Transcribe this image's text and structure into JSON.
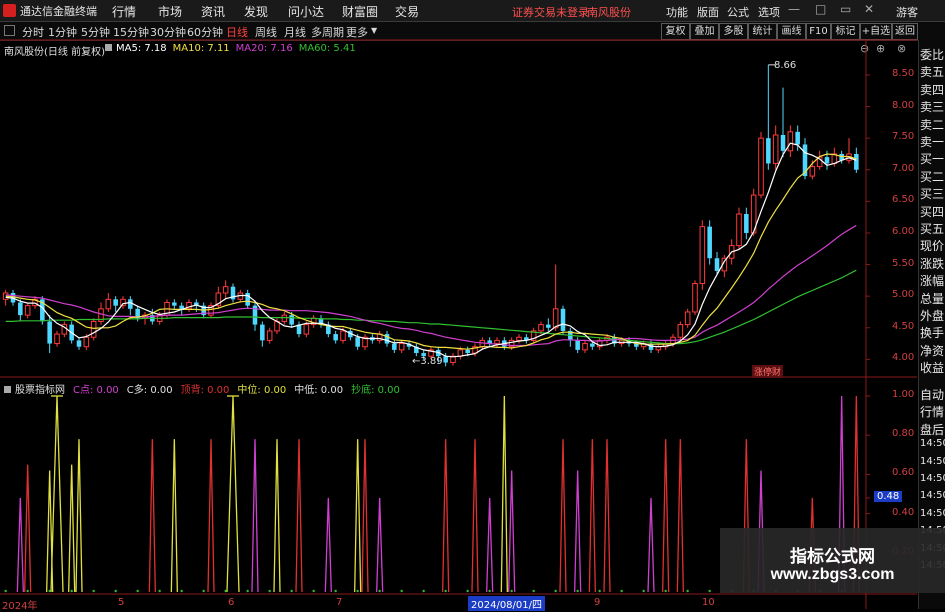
{
  "menubar": {
    "app_name": "通达信金融终端",
    "items": [
      "行情",
      "市场",
      "资讯",
      "发现",
      "问小达",
      "财富圈",
      "交易"
    ],
    "notice": "证券交易未登录",
    "stock": "南风股份",
    "right_items": [
      "功能",
      "版面",
      "公式",
      "选项"
    ],
    "guest": "游客"
  },
  "toolbar": {
    "periods": [
      "分时",
      "1分钟",
      "5分钟",
      "15分钟",
      "30分钟",
      "60分钟",
      "日线",
      "周线",
      "月线",
      "多周期",
      "更多"
    ],
    "active_period": "日线",
    "right_buttons": [
      "复权",
      "叠加",
      "多股",
      "统计",
      "画线",
      "F10",
      "标记",
      "+自选",
      "返回"
    ]
  },
  "chart_header": {
    "title": "南风股份(日线 前复权)",
    "ma": [
      {
        "label": "MA5: 7.18",
        "color": "#ffffff"
      },
      {
        "label": "MA10: 7.11",
        "color": "#f0e040"
      },
      {
        "label": "MA20: 7.16",
        "color": "#d040d0"
      },
      {
        "label": "MA60: 5.41",
        "color": "#30c030"
      }
    ]
  },
  "main_chart": {
    "yticks": [
      "8.50",
      "8.00",
      "7.50",
      "7.00",
      "6.50",
      "6.00",
      "5.50",
      "5.00",
      "4.50",
      "4.00"
    ],
    "high_label": "8.66",
    "low_label": "3.89",
    "badge": "涨停财"
  },
  "indicator": {
    "name": "股票指标网",
    "items": [
      {
        "label": "C点: 0.00",
        "color": "#d040d0"
      },
      {
        "label": "C多: 0.00",
        "color": "#e0e0e0"
      },
      {
        "label": "顶背: 0.00",
        "color": "#e03030"
      },
      {
        "label": "中位: 0.00",
        "color": "#e0e040"
      },
      {
        "label": "中低: 0.00",
        "color": "#e0e0e0"
      },
      {
        "label": "抄底: 0.00",
        "color": "#30c030"
      }
    ],
    "yticks": [
      "1.00",
      "0.80",
      "0.60",
      "0.48",
      "0.40",
      "0.20"
    ],
    "current_value": "0.48"
  },
  "x_axis": {
    "labels": [
      "2024年",
      "5",
      "6",
      "7",
      "2024/08/01/四",
      "9",
      "10"
    ]
  },
  "right_panel": {
    "quote_items": [
      "委比",
      "卖五",
      "卖四",
      "卖三",
      "卖二",
      "卖一",
      "买一",
      "买二",
      "买三",
      "买四",
      "买五",
      "现价",
      "涨跌",
      "涨幅",
      "总量",
      "外盘",
      "换手",
      "净资",
      "收益"
    ],
    "lower_items": [
      "自动",
      "行情",
      "盘后",
      "14:50",
      "14:50",
      "14:50",
      "14:50",
      "14:50",
      "14:50",
      "14:50",
      "14:50"
    ]
  },
  "watermark": {
    "line1": "指标公式网",
    "line2": "www.zbgs3.com"
  },
  "chart_data": {
    "type": "candlestick",
    "title": "南风股份(日线 前复权)",
    "ylim": [
      3.8,
      8.8
    ],
    "ma_values": {
      "MA5": 7.18,
      "MA10": 7.11,
      "MA20": 7.16,
      "MA60": 5.41
    },
    "candles": [
      [
        4.95,
        5.05,
        5.1,
        4.85
      ],
      [
        5.05,
        4.9,
        5.1,
        4.85
      ],
      [
        4.9,
        4.7,
        4.95,
        4.6
      ],
      [
        4.7,
        4.85,
        4.9,
        4.65
      ],
      [
        4.85,
        4.95,
        5.0,
        4.8
      ],
      [
        4.95,
        4.6,
        5.0,
        4.55
      ],
      [
        4.6,
        4.25,
        4.7,
        4.1
      ],
      [
        4.25,
        4.4,
        4.45,
        4.2
      ],
      [
        4.4,
        4.55,
        4.6,
        4.35
      ],
      [
        4.55,
        4.3,
        4.6,
        4.25
      ],
      [
        4.3,
        4.2,
        4.35,
        4.15
      ],
      [
        4.2,
        4.35,
        4.4,
        4.15
      ],
      [
        4.35,
        4.6,
        4.65,
        4.3
      ],
      [
        4.6,
        4.8,
        4.9,
        4.55
      ],
      [
        4.8,
        4.95,
        5.05,
        4.75
      ],
      [
        4.95,
        4.85,
        5.0,
        4.75
      ],
      [
        4.85,
        4.95,
        5.0,
        4.8
      ],
      [
        4.95,
        4.8,
        5.0,
        4.7
      ],
      [
        4.8,
        4.65,
        4.85,
        4.6
      ],
      [
        4.65,
        4.7,
        4.75,
        4.55
      ],
      [
        4.7,
        4.6,
        4.8,
        4.55
      ],
      [
        4.6,
        4.7,
        4.75,
        4.55
      ],
      [
        4.7,
        4.9,
        4.95,
        4.65
      ],
      [
        4.9,
        4.85,
        4.95,
        4.8
      ],
      [
        4.85,
        4.8,
        4.9,
        4.7
      ],
      [
        4.8,
        4.9,
        4.95,
        4.75
      ],
      [
        4.9,
        4.85,
        4.95,
        4.75
      ],
      [
        4.85,
        4.7,
        4.9,
        4.65
      ],
      [
        4.7,
        4.85,
        4.9,
        4.65
      ],
      [
        4.85,
        5.05,
        5.15,
        4.8
      ],
      [
        5.05,
        5.15,
        5.25,
        4.95
      ],
      [
        5.15,
        4.95,
        5.2,
        4.9
      ],
      [
        4.95,
        5.05,
        5.1,
        4.9
      ],
      [
        5.05,
        4.85,
        5.1,
        4.8
      ],
      [
        4.85,
        4.55,
        4.9,
        4.45
      ],
      [
        4.55,
        4.3,
        4.6,
        4.2
      ],
      [
        4.3,
        4.45,
        4.5,
        4.25
      ],
      [
        4.45,
        4.6,
        4.65,
        4.4
      ],
      [
        4.6,
        4.7,
        4.75,
        4.55
      ],
      [
        4.7,
        4.55,
        4.75,
        4.5
      ],
      [
        4.55,
        4.4,
        4.6,
        4.35
      ],
      [
        4.4,
        4.55,
        4.6,
        4.35
      ],
      [
        4.55,
        4.65,
        4.7,
        4.5
      ],
      [
        4.65,
        4.55,
        4.7,
        4.5
      ],
      [
        4.55,
        4.4,
        4.6,
        4.35
      ],
      [
        4.4,
        4.3,
        4.45,
        4.25
      ],
      [
        4.3,
        4.45,
        4.5,
        4.25
      ],
      [
        4.45,
        4.35,
        4.5,
        4.3
      ],
      [
        4.35,
        4.2,
        4.4,
        4.15
      ],
      [
        4.2,
        4.35,
        4.4,
        4.15
      ],
      [
        4.35,
        4.3,
        4.4,
        4.25
      ],
      [
        4.3,
        4.4,
        4.45,
        4.25
      ],
      [
        4.4,
        4.25,
        4.45,
        4.2
      ],
      [
        4.25,
        4.15,
        4.3,
        4.1
      ],
      [
        4.15,
        4.25,
        4.3,
        4.1
      ],
      [
        4.25,
        4.2,
        4.3,
        4.15
      ],
      [
        4.2,
        4.1,
        4.25,
        4.05
      ],
      [
        4.1,
        4.05,
        4.15,
        4.0
      ],
      [
        4.05,
        4.15,
        4.2,
        4.0
      ],
      [
        4.15,
        4.05,
        4.2,
        3.95
      ],
      [
        4.05,
        3.95,
        4.1,
        3.89
      ],
      [
        3.95,
        4.05,
        4.1,
        3.9
      ],
      [
        4.05,
        4.15,
        4.2,
        4.0
      ],
      [
        4.15,
        4.1,
        4.2,
        4.05
      ],
      [
        4.1,
        4.2,
        4.25,
        4.05
      ],
      [
        4.2,
        4.3,
        4.35,
        4.15
      ],
      [
        4.3,
        4.25,
        4.35,
        4.2
      ],
      [
        4.25,
        4.3,
        4.35,
        4.2
      ],
      [
        4.3,
        4.2,
        4.35,
        4.15
      ],
      [
        4.2,
        4.3,
        4.35,
        4.15
      ],
      [
        4.3,
        4.35,
        4.4,
        4.25
      ],
      [
        4.35,
        4.3,
        4.4,
        4.25
      ],
      [
        4.3,
        4.45,
        4.5,
        4.25
      ],
      [
        4.45,
        4.55,
        4.6,
        4.4
      ],
      [
        4.55,
        4.5,
        4.65,
        4.45
      ],
      [
        4.5,
        4.8,
        5.5,
        4.45
      ],
      [
        4.8,
        4.45,
        4.85,
        4.4
      ],
      [
        4.45,
        4.3,
        4.5,
        4.2
      ],
      [
        4.3,
        4.15,
        4.35,
        4.1
      ],
      [
        4.15,
        4.25,
        4.3,
        4.1
      ],
      [
        4.25,
        4.2,
        4.3,
        4.15
      ],
      [
        4.2,
        4.3,
        4.35,
        4.15
      ],
      [
        4.3,
        4.35,
        4.4,
        4.25
      ],
      [
        4.35,
        4.25,
        4.4,
        4.2
      ],
      [
        4.25,
        4.3,
        4.35,
        4.2
      ],
      [
        4.3,
        4.25,
        4.35,
        4.2
      ],
      [
        4.25,
        4.2,
        4.3,
        4.15
      ],
      [
        4.2,
        4.25,
        4.3,
        4.15
      ],
      [
        4.25,
        4.15,
        4.3,
        4.1
      ],
      [
        4.15,
        4.2,
        4.25,
        4.1
      ],
      [
        4.2,
        4.25,
        4.3,
        4.15
      ],
      [
        4.25,
        4.35,
        4.4,
        4.2
      ],
      [
        4.35,
        4.55,
        4.6,
        4.3
      ],
      [
        4.55,
        4.75,
        4.8,
        4.5
      ],
      [
        4.75,
        5.2,
        5.25,
        4.7
      ],
      [
        5.2,
        6.1,
        6.2,
        5.1
      ],
      [
        6.1,
        5.6,
        6.2,
        5.5
      ],
      [
        5.6,
        5.4,
        5.7,
        5.35
      ],
      [
        5.4,
        5.6,
        5.65,
        5.3
      ],
      [
        5.6,
        5.8,
        5.9,
        5.5
      ],
      [
        5.8,
        6.3,
        6.4,
        5.75
      ],
      [
        6.3,
        6.0,
        6.4,
        5.9
      ],
      [
        6.0,
        6.6,
        6.7,
        5.95
      ],
      [
        6.6,
        7.5,
        7.6,
        6.55
      ],
      [
        7.5,
        7.1,
        8.66,
        7.0
      ],
      [
        7.1,
        7.55,
        7.7,
        7.0
      ],
      [
        7.55,
        7.3,
        8.3,
        7.2
      ],
      [
        7.3,
        7.6,
        7.7,
        7.2
      ],
      [
        7.6,
        7.4,
        7.7,
        7.3
      ],
      [
        7.4,
        6.9,
        7.5,
        6.85
      ],
      [
        6.9,
        7.05,
        7.15,
        6.85
      ],
      [
        7.05,
        7.2,
        7.3,
        7.0
      ],
      [
        7.2,
        7.1,
        7.3,
        7.0
      ],
      [
        7.1,
        7.25,
        7.35,
        7.05
      ],
      [
        7.25,
        7.15,
        7.3,
        7.1
      ],
      [
        7.15,
        7.25,
        7.5,
        7.1
      ],
      [
        7.25,
        7.0,
        7.35,
        6.95
      ]
    ],
    "ma5": [
      4.98,
      4.97,
      4.92,
      4.89,
      4.89,
      4.82,
      4.67,
      4.57,
      4.51,
      4.42,
      4.34,
      4.36,
      4.42,
      4.49,
      4.59,
      4.73,
      4.88,
      4.9,
      4.84,
      4.79,
      4.74,
      4.71,
      4.73,
      4.75,
      4.79,
      4.83,
      4.86,
      4.82,
      4.82,
      4.88,
      4.96,
      4.99,
      5.01,
      5.01,
      4.92,
      4.77,
      4.66,
      4.6,
      4.53,
      4.51,
      4.54,
      4.57,
      4.57,
      4.57,
      4.54,
      4.49,
      4.47,
      4.41,
      4.36,
      4.33,
      4.33,
      4.33,
      4.3,
      4.26,
      4.27,
      4.24,
      4.19,
      4.15,
      4.13,
      4.11,
      4.05,
      4.04,
      4.05,
      4.07,
      4.09,
      4.16,
      4.2,
      4.23,
      4.25,
      4.27,
      4.29,
      4.3,
      4.33,
      4.38,
      4.43,
      4.52,
      4.56,
      4.53,
      4.44,
      4.39,
      4.28,
      4.22,
      4.23,
      4.27,
      4.27,
      4.27,
      4.27,
      4.25,
      4.21,
      4.2,
      4.21,
      4.23,
      4.29,
      4.39,
      4.56,
      4.87,
      5.13,
      5.34,
      5.55,
      5.7,
      5.74,
      5.82,
      6.02,
      6.34,
      6.64,
      6.98,
      7.24,
      7.42,
      7.39,
      7.27,
      7.23,
      7.17,
      7.07,
      7.1,
      7.15,
      7.19,
      7.15
    ],
    "ma10": [
      5.0,
      4.99,
      4.97,
      4.95,
      4.94,
      4.9,
      4.82,
      4.74,
      4.69,
      4.65,
      4.58,
      4.51,
      4.49,
      4.5,
      4.5,
      4.53,
      4.6,
      4.66,
      4.67,
      4.69,
      4.73,
      4.79,
      4.8,
      4.79,
      4.79,
      4.79,
      4.79,
      4.78,
      4.79,
      4.81,
      4.85,
      4.88,
      4.91,
      4.92,
      4.9,
      4.87,
      4.82,
      4.8,
      4.77,
      4.72,
      4.66,
      4.62,
      4.58,
      4.55,
      4.53,
      4.52,
      4.52,
      4.49,
      4.46,
      4.43,
      4.41,
      4.4,
      4.36,
      4.31,
      4.3,
      4.29,
      4.26,
      4.22,
      4.2,
      4.19,
      4.19,
      4.18,
      4.17,
      4.16,
      4.18,
      4.2,
      4.2,
      4.19,
      4.19,
      4.18,
      4.2,
      4.22,
      4.26,
      4.31,
      4.34,
      4.4,
      4.43,
      4.43,
      4.41,
      4.41,
      4.4,
      4.39,
      4.38,
      4.35,
      4.33,
      4.28,
      4.25,
      4.24,
      4.24,
      4.24,
      4.24,
      4.25,
      4.27,
      4.3,
      4.38,
      4.54,
      4.69,
      4.81,
      4.97,
      5.13,
      5.3,
      5.48,
      5.68,
      5.94,
      6.17,
      6.36,
      6.53,
      6.71,
      6.87,
      6.96,
      7.1,
      7.21,
      7.25,
      7.24,
      7.21,
      7.21,
      7.17
    ],
    "ma20": [
      5.02,
      5.01,
      5.0,
      4.99,
      4.98,
      4.97,
      4.94,
      4.91,
      4.88,
      4.86,
      4.83,
      4.79,
      4.75,
      4.72,
      4.69,
      4.68,
      4.68,
      4.68,
      4.67,
      4.67,
      4.68,
      4.69,
      4.7,
      4.7,
      4.7,
      4.71,
      4.72,
      4.73,
      4.73,
      4.74,
      4.76,
      4.78,
      4.8,
      4.81,
      4.8,
      4.79,
      4.78,
      4.78,
      4.78,
      4.77,
      4.77,
      4.77,
      4.76,
      4.75,
      4.74,
      4.72,
      4.7,
      4.68,
      4.65,
      4.62,
      4.59,
      4.57,
      4.54,
      4.51,
      4.49,
      4.48,
      4.46,
      4.43,
      4.41,
      4.38,
      4.35,
      4.33,
      4.31,
      4.29,
      4.27,
      4.26,
      4.25,
      4.24,
      4.23,
      4.22,
      4.22,
      4.22,
      4.23,
      4.24,
      4.25,
      4.29,
      4.31,
      4.31,
      4.3,
      4.3,
      4.29,
      4.29,
      4.3,
      4.31,
      4.32,
      4.33,
      4.33,
      4.32,
      4.31,
      4.3,
      4.3,
      4.3,
      4.31,
      4.32,
      4.35,
      4.43,
      4.49,
      4.54,
      4.61,
      4.68,
      4.75,
      4.82,
      4.9,
      5.0,
      5.11,
      5.21,
      5.31,
      5.4,
      5.49,
      5.56,
      5.64,
      5.72,
      5.8,
      5.89,
      5.98,
      6.05,
      6.12
    ],
    "ma60": [
      4.6,
      4.6,
      4.61,
      4.61,
      4.61,
      4.61,
      4.62,
      4.62,
      4.62,
      4.62,
      4.63,
      4.63,
      4.63,
      4.63,
      4.64,
      4.64,
      4.64,
      4.64,
      4.64,
      4.65,
      4.65,
      4.65,
      4.65,
      4.66,
      4.66,
      4.66,
      4.66,
      4.66,
      4.66,
      4.66,
      4.67,
      4.67,
      4.67,
      4.67,
      4.67,
      4.66,
      4.66,
      4.66,
      4.66,
      4.66,
      4.65,
      4.65,
      4.65,
      4.64,
      4.64,
      4.64,
      4.63,
      4.63,
      4.62,
      4.62,
      4.61,
      4.61,
      4.6,
      4.6,
      4.59,
      4.58,
      4.58,
      4.57,
      4.56,
      4.56,
      4.55,
      4.54,
      4.53,
      4.52,
      4.51,
      4.5,
      4.49,
      4.48,
      4.47,
      4.46,
      4.45,
      4.44,
      4.43,
      4.42,
      4.41,
      4.4,
      4.39,
      4.38,
      4.37,
      4.36,
      4.35,
      4.34,
      4.33,
      4.32,
      4.31,
      4.3,
      4.29,
      4.28,
      4.27,
      4.26,
      4.25,
      4.25,
      4.25,
      4.26,
      4.28,
      4.31,
      4.35,
      4.39,
      4.43,
      4.48,
      4.53,
      4.58,
      4.63,
      4.69,
      4.75,
      4.81,
      4.87,
      4.93,
      4.99,
      5.04,
      5.09,
      5.14,
      5.19,
      5.24,
      5.29,
      5.35,
      5.41
    ],
    "indicator_ylim": [
      0,
      1.0
    ],
    "indicator_spikes": [
      {
        "i": 2,
        "h": 0.48,
        "c": "#d040d0",
        "w": 3
      },
      {
        "i": 3,
        "h": 0.65,
        "c": "#e03030",
        "w": 3
      },
      {
        "i": 6,
        "h": 0.62,
        "c": "#e0e040",
        "w": 3
      },
      {
        "i": 7,
        "h": 1.0,
        "c": "#e0e040",
        "w": 6
      },
      {
        "i": 9,
        "h": 0.65,
        "c": "#e0e040",
        "w": 3
      },
      {
        "i": 10,
        "h": 0.78,
        "c": "#e0e040",
        "w": 3
      },
      {
        "i": 20,
        "h": 0.78,
        "c": "#e03030",
        "w": 3
      },
      {
        "i": 23,
        "h": 0.78,
        "c": "#e0e040",
        "w": 3
      },
      {
        "i": 28,
        "h": 0.78,
        "c": "#e03030",
        "w": 3
      },
      {
        "i": 31,
        "h": 1.0,
        "c": "#e0e040",
        "w": 6
      },
      {
        "i": 34,
        "h": 0.78,
        "c": "#d040d0",
        "w": 3
      },
      {
        "i": 37,
        "h": 0.78,
        "c": "#e0e040",
        "w": 3
      },
      {
        "i": 40,
        "h": 0.78,
        "c": "#e03030",
        "w": 3
      },
      {
        "i": 44,
        "h": 0.48,
        "c": "#d040d0",
        "w": 3
      },
      {
        "i": 48,
        "h": 0.78,
        "c": "#e0e040",
        "w": 3
      },
      {
        "i": 49,
        "h": 0.78,
        "c": "#e03030",
        "w": 3
      },
      {
        "i": 51,
        "h": 0.48,
        "c": "#d040d0",
        "w": 3
      },
      {
        "i": 60,
        "h": 0.78,
        "c": "#e03030",
        "w": 3
      },
      {
        "i": 64,
        "h": 0.78,
        "c": "#e03030",
        "w": 3
      },
      {
        "i": 66,
        "h": 0.48,
        "c": "#d040d0",
        "w": 3
      },
      {
        "i": 68,
        "h": 1.0,
        "c": "#e0e040",
        "w": 3
      },
      {
        "i": 69,
        "h": 0.62,
        "c": "#d040d0",
        "w": 3
      },
      {
        "i": 76,
        "h": 0.78,
        "c": "#e03030",
        "w": 3
      },
      {
        "i": 78,
        "h": 0.62,
        "c": "#d040d0",
        "w": 3
      },
      {
        "i": 80,
        "h": 0.78,
        "c": "#e03030",
        "w": 3
      },
      {
        "i": 82,
        "h": 0.78,
        "c": "#e03030",
        "w": 3
      },
      {
        "i": 88,
        "h": 0.48,
        "c": "#d040d0",
        "w": 3
      },
      {
        "i": 90,
        "h": 0.78,
        "c": "#e03030",
        "w": 3
      },
      {
        "i": 92,
        "h": 0.78,
        "c": "#e03030",
        "w": 3
      },
      {
        "i": 101,
        "h": 0.78,
        "c": "#e03030",
        "w": 3
      },
      {
        "i": 103,
        "h": 0.62,
        "c": "#d040d0",
        "w": 3
      },
      {
        "i": 110,
        "h": 0.48,
        "c": "#e03030",
        "w": 3
      },
      {
        "i": 114,
        "h": 1.0,
        "c": "#d040d0",
        "w": 3
      },
      {
        "i": 116,
        "h": 1.0,
        "c": "#e03030",
        "w": 3
      }
    ],
    "xlabels": [
      "2024年",
      "5",
      "6",
      "7",
      "2024/08/01/四",
      "9",
      "10"
    ]
  }
}
